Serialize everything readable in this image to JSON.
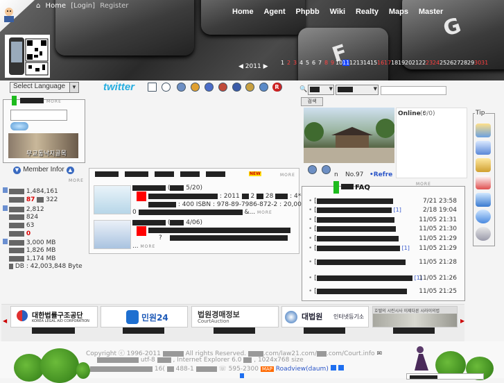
{
  "header": {
    "home": "Home",
    "login": "[Login]",
    "register": "Register",
    "nav": [
      "Home",
      "Agent",
      "Phpbb",
      "Wiki",
      "Realty",
      "Maps",
      "Master"
    ],
    "key_glyph": "F",
    "key_glyph2": "G",
    "cal_year": "2011",
    "cal_prev": "◀",
    "cal_next": "▶",
    "days": [
      {
        "d": "1",
        "c": "w"
      },
      {
        "d": "2",
        "c": "r"
      },
      {
        "d": "3",
        "c": "r"
      },
      {
        "d": "4",
        "c": "w"
      },
      {
        "d": "5",
        "c": "w"
      },
      {
        "d": "6",
        "c": "w"
      },
      {
        "d": "7",
        "c": "w"
      },
      {
        "d": "8",
        "c": "r"
      },
      {
        "d": "9",
        "c": "r"
      },
      {
        "d": "10",
        "c": "w"
      },
      {
        "d": "11",
        "c": "t"
      },
      {
        "d": "12",
        "c": "w"
      },
      {
        "d": "13",
        "c": "w"
      },
      {
        "d": "14",
        "c": "w"
      },
      {
        "d": "15",
        "c": "w"
      },
      {
        "d": "16",
        "c": "r"
      },
      {
        "d": "17",
        "c": "r"
      },
      {
        "d": "18",
        "c": "w"
      },
      {
        "d": "19",
        "c": "w"
      },
      {
        "d": "20",
        "c": "w"
      },
      {
        "d": "21",
        "c": "w"
      },
      {
        "d": "22",
        "c": "w"
      },
      {
        "d": "23",
        "c": "r"
      },
      {
        "d": "24",
        "c": "r"
      },
      {
        "d": "25",
        "c": "w"
      },
      {
        "d": "26",
        "c": "w"
      },
      {
        "d": "27",
        "c": "w"
      },
      {
        "d": "28",
        "c": "w"
      },
      {
        "d": "29",
        "c": "w"
      },
      {
        "d": "30",
        "c": "r"
      },
      {
        "d": "31",
        "c": "r"
      }
    ]
  },
  "toolbar": {
    "language": "Select Language",
    "twitter": "twitter",
    "r_badge": "R"
  },
  "search": {
    "button": "검색",
    "online_label": "Online :",
    "online_value": "(0/0)"
  },
  "login_panel": {
    "more": "MORE",
    "banner_text": "무교동낙지골목"
  },
  "member": {
    "title": "Member Infor",
    "more": "MORE",
    "stats": [
      {
        "value": "1,484,161",
        "extra": ""
      },
      {
        "value": "87",
        "extra": "322"
      },
      {
        "value": "2,812",
        "extra": ""
      },
      {
        "value": "824",
        "extra": ""
      },
      {
        "value": "63",
        "extra": ""
      },
      {
        "value": "0",
        "extra": ""
      },
      {
        "value": "3,000 MB",
        "extra": ""
      },
      {
        "value": "1,826 MB",
        "extra": ""
      },
      {
        "value": "1,174 MB",
        "extra": ""
      },
      {
        "value": "DB : 42,003,848 Byte",
        "extra": ""
      }
    ]
  },
  "news": {
    "more": "MORE",
    "new_badge": "NEW",
    "item1_count": "5/20",
    "item1_line1": ": 2011",
    "item1_mid": "2",
    "item1_mid2": "28",
    "item1_num": ": 4*6",
    "item1_isbn": ": 400 ISBN : 978-89-7986-872-2",
    "item1_price": ": 20,00",
    "item1_prefix": "0",
    "item1_tail": "&...",
    "item2_count": "4/06",
    "item2_tail": "?",
    "item2_end": "...",
    "more2": "MORE"
  },
  "photo": {
    "number": "No.97",
    "refresh": "•Refre",
    "n": "n"
  },
  "faq": {
    "title": "FAQ",
    "more": "MORE",
    "rows": [
      {
        "time": "7/21 23:58",
        "cite": ""
      },
      {
        "time": "2/18 19:04",
        "cite": "[1]"
      },
      {
        "time": "11/05 21:31",
        "cite": ""
      },
      {
        "time": "11/05 21:30",
        "cite": ""
      },
      {
        "time": "11/05 21:29",
        "cite": ""
      },
      {
        "time": "11/05 21:29",
        "cite": "[1]"
      },
      {
        "time": "11/05 21:28",
        "cite": ""
      },
      {
        "time": "11/05 21:26",
        "cite": "[1]"
      },
      {
        "time": "11/05 21:25",
        "cite": ""
      }
    ]
  },
  "tip": {
    "title": "Tip"
  },
  "banners": [
    {
      "title": "대한법률구조공단",
      "sub": "KOREA LEGAL AID CORPORATION"
    },
    {
      "title": "민원24",
      "sub": ""
    },
    {
      "title": "법원경매정보",
      "sub": "CourtAuction"
    },
    {
      "title": "대법원",
      "sub": "인터넷등기소"
    },
    {
      "title": "호텔의 시린시사 이제다른 시라이의법",
      "sub": ""
    }
  ],
  "footer": {
    "copyright": "Copyright",
    "years": "1996-2011",
    "rights": "All rights Reserved.",
    "domain1": ".com/law21.com/",
    "domain2": ".com/Court.info",
    "utf": "utf-8",
    "browser": ", Internet Explorer 6.0",
    "resolution": ", 1024x768 size",
    "addr": "16(",
    "addr2": "488-1",
    "phone": "595-2300",
    "map": "MAP",
    "roadview": "Roadview(daum)"
  },
  "colors": {
    "twitter": "#27aee0",
    "green": "#1dbb1d",
    "red": "#ff0000",
    "today": "#1846ff",
    "link": "#3355cc"
  }
}
